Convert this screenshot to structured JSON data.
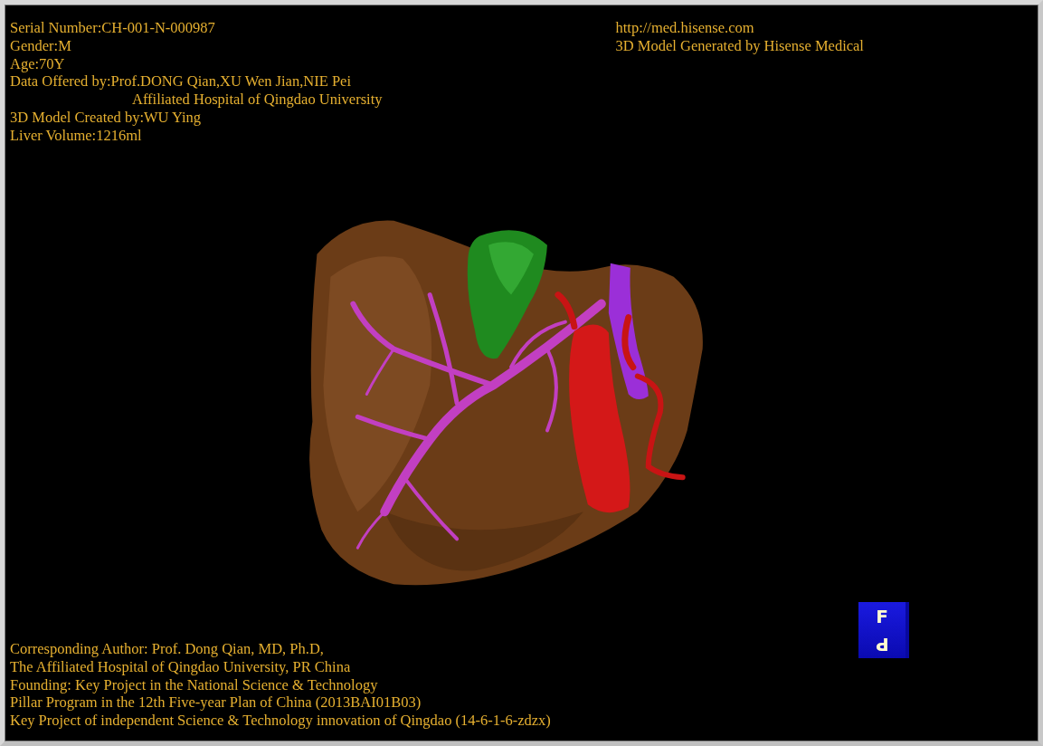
{
  "info_left": [
    {
      "text": "Serial Number:CH-001-N-000987",
      "kind": "line"
    },
    {
      "text": "Gender:M",
      "kind": "line"
    },
    {
      "text": "Age:70Y",
      "kind": "line"
    },
    {
      "text": "Data Offered by:Prof.DONG Qian,XU Wen Jian,NIE Pei",
      "kind": "line"
    },
    {
      "text": "Affiliated Hospital of Qingdao University",
      "kind": "continuation"
    },
    {
      "text": "3D Model Created by:WU Ying",
      "kind": "line"
    },
    {
      "text": "Liver Volume:1216ml",
      "kind": "line"
    }
  ],
  "info_right": [
    "http://med.hisense.com",
    "3D Model Generated by Hisense Medical"
  ],
  "orientation_cube": {
    "faces": [
      {
        "label": "F",
        "kind": "upright"
      },
      {
        "label": "P",
        "kind": "inverted"
      }
    ]
  },
  "credits": [
    "Corresponding Author: Prof. Dong Qian, MD, Ph.D,",
    "The Affiliated Hospital of Qingdao University, PR China",
    "Founding: Key Project in the National Science & Technology",
    "Pillar Program in the 12th Five-year Plan of China (2013BAI01B03)",
    "Key Project of independent Science & Technology innovation of Qingdao (14-6-1-6-zdzx)"
  ]
}
